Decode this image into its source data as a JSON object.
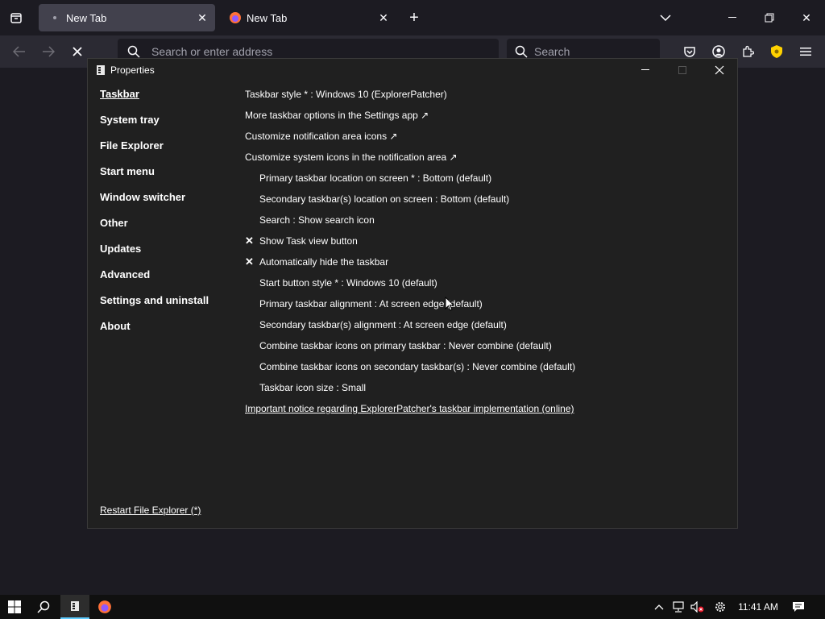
{
  "browser": {
    "tabs": [
      {
        "label": "New Tab",
        "active": true
      },
      {
        "label": "New Tab",
        "active": false
      }
    ],
    "urlbar_placeholder": "Search or enter address",
    "searchbar_placeholder": "Search"
  },
  "properties_window": {
    "title": "Properties",
    "sidebar": [
      {
        "label": "Taskbar",
        "selected": true
      },
      {
        "label": "System tray"
      },
      {
        "label": "File Explorer"
      },
      {
        "label": "Start menu"
      },
      {
        "label": "Window switcher"
      },
      {
        "label": "Other"
      },
      {
        "label": "Updates"
      },
      {
        "label": "Advanced"
      },
      {
        "label": "Settings and uninstall"
      },
      {
        "label": "About"
      }
    ],
    "restart_link": "Restart File Explorer (*)",
    "options": [
      {
        "label": "Taskbar style * : Windows 10 (ExplorerPatcher)",
        "indent": false
      },
      {
        "label": "More taskbar options in the Settings app ↗",
        "indent": false
      },
      {
        "label": "Customize notification area icons ↗",
        "indent": false
      },
      {
        "label": "Customize system icons in the notification area ↗",
        "indent": false
      },
      {
        "label": "Primary taskbar location on screen * : Bottom (default)",
        "indent": true
      },
      {
        "label": "Secondary taskbar(s) location on screen : Bottom (default)",
        "indent": true
      },
      {
        "label": "Search : Show search icon",
        "indent": true
      },
      {
        "label": "Show Task view button",
        "indent": true,
        "checked": true
      },
      {
        "label": "Automatically hide the taskbar",
        "indent": true,
        "checked": true
      },
      {
        "label": "Start button style * : Windows 10 (default)",
        "indent": true
      },
      {
        "label": "Primary taskbar alignment : At screen edge (default)",
        "indent": true
      },
      {
        "label": "Secondary taskbar(s) alignment : At screen edge (default)",
        "indent": true
      },
      {
        "label": "Combine taskbar icons on primary taskbar : Never combine (default)",
        "indent": true
      },
      {
        "label": "Combine taskbar icons on secondary taskbar(s) : Never combine (default)",
        "indent": true
      },
      {
        "label": "Taskbar icon size : Small",
        "indent": true
      },
      {
        "label": "Important notice regarding ExplorerPatcher's taskbar implementation (online)",
        "indent": false,
        "link": true
      }
    ],
    "check_glyph": "✕"
  },
  "taskbar": {
    "clock": "11:41 AM"
  },
  "colors": {
    "accent": "#60cdff",
    "firefox_orange": "#ff7139",
    "shield_yellow": "#ffd200"
  }
}
